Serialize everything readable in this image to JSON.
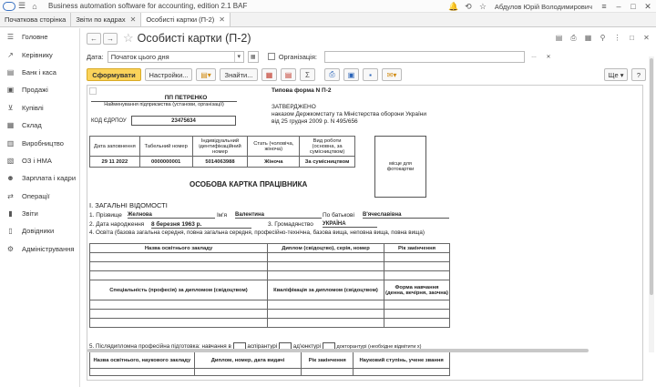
{
  "titlebar": {
    "app_title": "Business automation software for accounting, edition 2.1 BAF",
    "user": "Абдулов Юрій Володимирович"
  },
  "tabs": [
    {
      "label": "Початкова сторінка"
    },
    {
      "label": "Звіти по кадрах"
    },
    {
      "label": "Особисті картки (П-2)"
    }
  ],
  "sidebar": {
    "items": [
      {
        "label": "Головне",
        "icon": "menu-icon"
      },
      {
        "label": "Керівнику",
        "icon": "trend-icon"
      },
      {
        "label": "Банк і каса",
        "icon": "bank-icon"
      },
      {
        "label": "Продажі",
        "icon": "bag-icon"
      },
      {
        "label": "Купівлі",
        "icon": "cart-icon"
      },
      {
        "label": "Склад",
        "icon": "box-icon"
      },
      {
        "label": "Виробництво",
        "icon": "factory-icon"
      },
      {
        "label": "ОЗ і НМА",
        "icon": "building-icon"
      },
      {
        "label": "Зарплата і кадри",
        "icon": "people-icon"
      },
      {
        "label": "Операції",
        "icon": "operations-icon"
      },
      {
        "label": "Звіти",
        "icon": "chart-icon"
      },
      {
        "label": "Довідники",
        "icon": "book-icon"
      },
      {
        "label": "Адміністрування",
        "icon": "gear-icon"
      }
    ]
  },
  "doc": {
    "title": "Особисті картки (П-2)",
    "date_label": "Дата:",
    "date_value": "Початок цього дня",
    "org_label": "Організація:",
    "generate_btn": "Сформувати",
    "settings_btn": "Настройки...",
    "find_btn": "Знайти...",
    "more_btn": "Ще",
    "help_btn": "?"
  },
  "form": {
    "org_name": "ПП ПЕТРЕНКО",
    "org_caption": "Найменування підприємства (установи, організації)",
    "edrpou_label": "КОД ЄДРПОУ",
    "edrpou": "23475634",
    "typical_form": "Типова форма N П-2",
    "approved": "ЗАТВЕРДЖЕНО",
    "approved_l2": "наказом Держкомстату та Міністерства оборони України",
    "approved_l3": "від 25 грудня 2009 р. N 495/656",
    "t1_h1": "Дата заповнення",
    "t1_h2": "Табельний номер",
    "t1_h3": "Індивідуальний ідентифікаційний номер",
    "t1_h4": "Стать (чоловіча, жіноча)",
    "t1_h5": "Вид роботи (основна, за сумісництвом)",
    "t1_v1": "29 11 2022",
    "t1_v2": "0000000001",
    "t1_v3": "5014063988",
    "t1_v4": "Жіноча",
    "t1_v5": "За сумісництвом",
    "photo": "місце для фотокартки",
    "card_title": "ОСОБОВА КАРТКА ПРАЦІВНИКА",
    "section1": "І. ЗАГАЛЬНІ ВІДОМОСТІ",
    "surname_label": "1. Прізвище",
    "surname": "Желнова",
    "name_label": "Ім'я",
    "name": "Валентина",
    "patronymic_label": "По батькові",
    "patronymic": "В'ячеславівна",
    "dob_label": "2. Дата народження",
    "dob": "8 березня 1963 р.",
    "citizenship_label": "3.  Громадянство",
    "citizenship": "УКРАЇНА",
    "education_label": "4. Освіта (базова загальна середня, повна загальна середня, професійно-технічна, базова вища, неповна вища, повна вища)",
    "t2_h1": "Назва освітнього закладу",
    "t2_h2": "Диплом (свідоцтво), серія, номер",
    "t2_h3": "Рік закінчення",
    "t2_h4": "Спеціальність (професія) за дипломом (свідоцтвом)",
    "t2_h5": "Кваліфікація за дипломом (свідоцтвом)",
    "t2_h6": "Форма навчання (денна, вечірня, заочна)",
    "postgrad_label": "5. Післядипломна професійна підготовка:  навчання в",
    "postgrad_a": "аспірантурі",
    "postgrad_b": "ад'юнктурі",
    "postgrad_c": "докторантурі (необхідне відмітити х)",
    "t3_h1": "Назва освітнього, наукового  закладу",
    "t3_h2": "Диплом, номер, дата видачі",
    "t3_h3": "Рік закінчення",
    "t3_h4": "Науковий ступінь, учене звання"
  }
}
